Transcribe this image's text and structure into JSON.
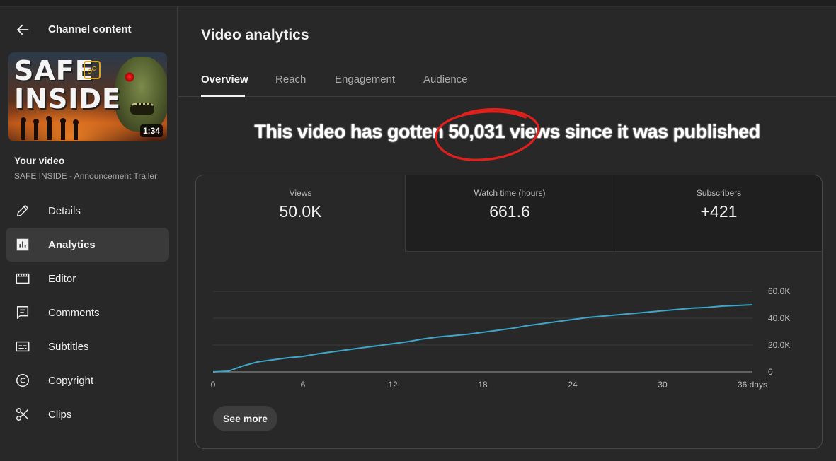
{
  "sidebar": {
    "title": "Channel content",
    "thumbnail": {
      "title_text": "SAFE INSIDE",
      "duration": "1:34"
    },
    "your_video_label": "Your video",
    "video_name": "SAFE INSIDE - Announcement Trailer",
    "items": [
      {
        "label": "Details",
        "icon": "pencil-icon",
        "active": false
      },
      {
        "label": "Analytics",
        "icon": "analytics-icon",
        "active": true
      },
      {
        "label": "Editor",
        "icon": "film-icon",
        "active": false
      },
      {
        "label": "Comments",
        "icon": "comment-icon",
        "active": false
      },
      {
        "label": "Subtitles",
        "icon": "subtitles-icon",
        "active": false
      },
      {
        "label": "Copyright",
        "icon": "copyright-icon",
        "active": false
      },
      {
        "label": "Clips",
        "icon": "scissors-icon",
        "active": false
      }
    ]
  },
  "main": {
    "title": "Video analytics",
    "tabs": [
      {
        "label": "Overview",
        "active": true
      },
      {
        "label": "Reach",
        "active": false
      },
      {
        "label": "Engagement",
        "active": false
      },
      {
        "label": "Audience",
        "active": false
      }
    ],
    "headline": "This video has gotten 50,031 views since it was published",
    "metrics": [
      {
        "label": "Views",
        "value": "50.0K"
      },
      {
        "label": "Watch time (hours)",
        "value": "661.6"
      },
      {
        "label": "Subscribers",
        "value": "+421"
      }
    ],
    "see_more_label": "See more"
  },
  "colors": {
    "background": "#282828",
    "line": "#3ea6c8",
    "annotation": "#e0201c"
  },
  "chart_data": {
    "type": "line",
    "x": [
      0,
      1,
      2,
      3,
      4,
      5,
      6,
      7,
      8,
      9,
      10,
      11,
      12,
      13,
      14,
      15,
      16,
      17,
      18,
      19,
      20,
      21,
      22,
      23,
      24,
      25,
      26,
      27,
      28,
      29,
      30,
      31,
      32,
      33,
      34,
      35,
      36
    ],
    "series": [
      {
        "values": [
          0,
          500,
          4500,
          7500,
          9000,
          10500,
          11500,
          13500,
          15000,
          16500,
          18000,
          19500,
          21000,
          22500,
          24500,
          26000,
          27000,
          28000,
          29500,
          31000,
          32500,
          34500,
          36000,
          37500,
          39000,
          40500,
          41500,
          42500,
          43500,
          44500,
          45500,
          46500,
          47500,
          48000,
          49000,
          49500,
          50031
        ]
      }
    ],
    "x_ticks": [
      "0",
      "6",
      "12",
      "18",
      "24",
      "30",
      "36 days"
    ],
    "x_tick_values": [
      0,
      6,
      12,
      18,
      24,
      30,
      36
    ],
    "y_ticks": [
      "0",
      "20.0K",
      "40.0K",
      "60.0K"
    ],
    "y_tick_values": [
      0,
      20000,
      40000,
      60000
    ],
    "xlim": [
      0,
      36
    ],
    "ylim": [
      0,
      60000
    ],
    "grid": true,
    "y_axis_side": "right"
  }
}
